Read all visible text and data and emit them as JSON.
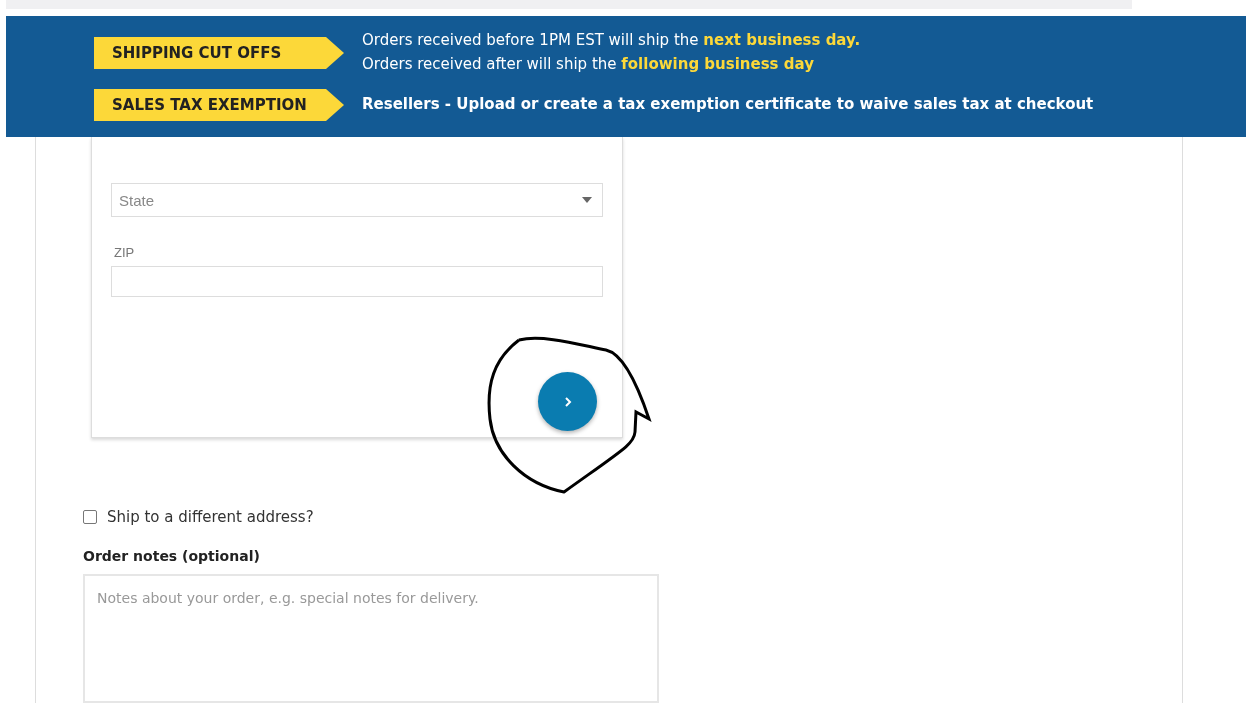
{
  "banner": {
    "rows": [
      {
        "tag": "SHIPPING CUT OFFS",
        "lines": [
          "Orders received before 1PM EST will ship the **next business day.**",
          "Orders received after will ship the **following business day**"
        ],
        "bold": false
      },
      {
        "tag": "SALES TAX EXEMPTION",
        "lines": [
          "Resellers - Upload or create a tax exemption certificate to waive sales tax at checkout"
        ],
        "bold": true
      }
    ]
  },
  "address_form": {
    "state": {
      "placeholder": "State"
    },
    "zip": {
      "label": "ZIP"
    }
  },
  "ship_different": {
    "label": "Ship to a different address?",
    "checked": false
  },
  "order_notes": {
    "label": "Order notes (optional)",
    "placeholder": "Notes about your order, e.g. special notes for delivery."
  }
}
